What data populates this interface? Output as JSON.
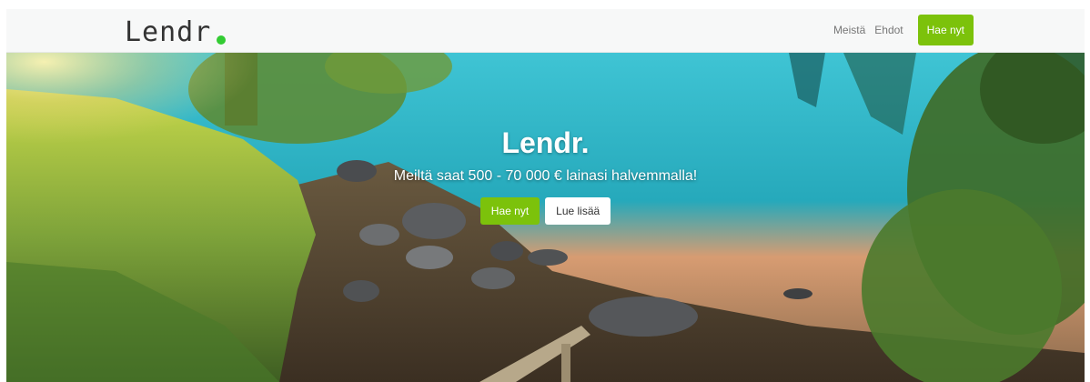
{
  "navbar": {
    "brand": "Lendr",
    "links": [
      "Meistä",
      "Ehdot"
    ],
    "cta": "Hae nyt"
  },
  "hero": {
    "title": "Lendr.",
    "subtitle": "Meiltä saat 500 - 70 000 € lainasi halvemmalla!",
    "primary_button": "Hae nyt",
    "secondary_button": "Lue lisää"
  },
  "colors": {
    "accent_green": "#7cc20b",
    "logo_dot": "#33cc33",
    "navbar_bg": "#f7f8f8"
  },
  "icons": {
    "logo": "green-dot-icon"
  }
}
